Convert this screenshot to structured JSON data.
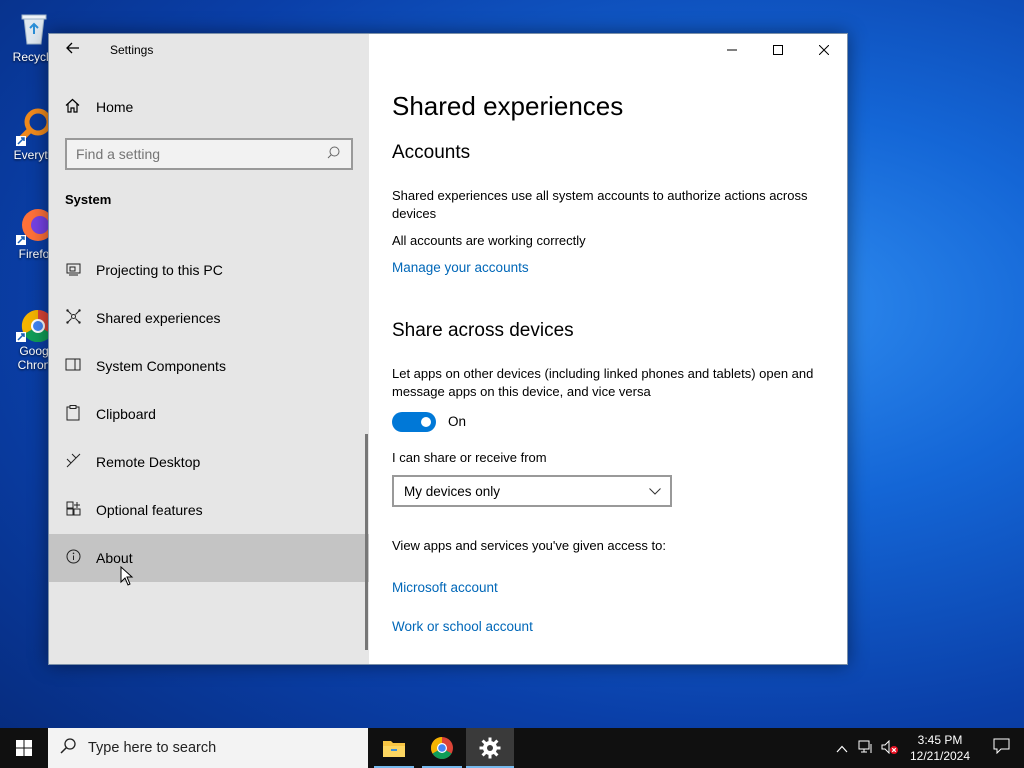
{
  "desktop": {
    "icons": [
      {
        "label": "Recycle",
        "icon": "recycle-bin-icon"
      },
      {
        "label": "Everyth",
        "icon": "everything-search-icon"
      },
      {
        "label": "Firefo",
        "icon": "firefox-icon"
      },
      {
        "label": "Goog\nChron",
        "icon": "chrome-icon"
      }
    ]
  },
  "window": {
    "app_title": "Settings",
    "home_label": "Home",
    "search_placeholder": "Find a setting",
    "section": "System",
    "nav_items": [
      {
        "label": "Projecting to this PC",
        "icon": "projector-icon"
      },
      {
        "label": "Shared experiences",
        "icon": "shared-experiences-icon"
      },
      {
        "label": "System Components",
        "icon": "components-icon"
      },
      {
        "label": "Clipboard",
        "icon": "clipboard-icon"
      },
      {
        "label": "Remote Desktop",
        "icon": "remote-desktop-icon"
      },
      {
        "label": "Optional features",
        "icon": "optional-features-icon"
      },
      {
        "label": "About",
        "icon": "info-icon"
      }
    ],
    "selected_nav": "About"
  },
  "content": {
    "page_title": "Shared experiences",
    "accounts": {
      "heading": "Accounts",
      "description": "Shared experiences use all system accounts to authorize actions across devices",
      "status": "All accounts are working correctly",
      "manage_link": "Manage your accounts"
    },
    "share": {
      "heading": "Share across devices",
      "description": "Let apps on other devices (including linked phones and tablets) open and message apps on this device, and vice versa",
      "toggle_state": "On",
      "share_label": "I can share or receive from",
      "dropdown_value": "My devices only",
      "access_label": "View apps and services you've given access to:",
      "microsoft_link": "Microsoft account",
      "work_link": "Work or school account"
    }
  },
  "taskbar": {
    "search_placeholder": "Type here to search",
    "time": "3:45 PM",
    "date": "12/21/2024"
  },
  "colors": {
    "accent": "#0078d7",
    "link": "#0067b8",
    "sidebar_bg": "#e6e6e6",
    "selected_bg": "#c4c4c4"
  }
}
